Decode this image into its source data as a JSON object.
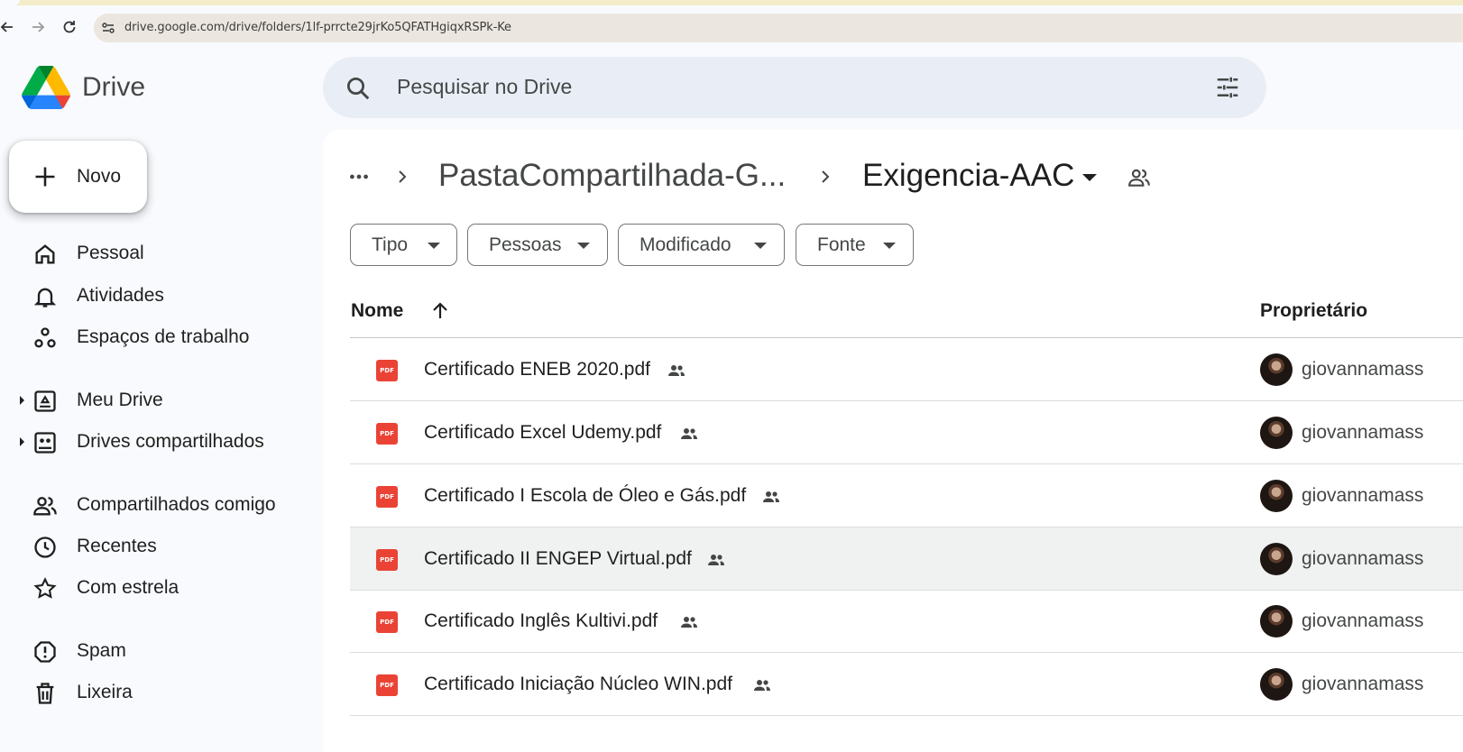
{
  "browser": {
    "url": "drive.google.com/drive/folders/1lf-prrcte29jrKo5QFATHgiqxRSPk-Ke"
  },
  "app": {
    "title": "Drive"
  },
  "search": {
    "placeholder": "Pesquisar no Drive"
  },
  "new_button": {
    "label": "Novo"
  },
  "sidebar": {
    "items": [
      {
        "label": "Pessoal",
        "icon": "home-icon"
      },
      {
        "label": "Atividades",
        "icon": "bell-icon"
      },
      {
        "label": "Espaços de trabalho",
        "icon": "workspaces-icon"
      },
      {
        "label": "Meu Drive",
        "icon": "my-drive-icon"
      },
      {
        "label": "Drives compartilhados",
        "icon": "shared-drives-icon"
      },
      {
        "label": "Compartilhados comigo",
        "icon": "people-icon"
      },
      {
        "label": "Recentes",
        "icon": "clock-icon"
      },
      {
        "label": "Com estrela",
        "icon": "star-icon"
      },
      {
        "label": "Spam",
        "icon": "spam-icon"
      },
      {
        "label": "Lixeira",
        "icon": "trash-icon"
      }
    ]
  },
  "breadcrumb": {
    "parent": "PastaCompartilhada-G...",
    "current": "Exigencia-AAC"
  },
  "filters": [
    {
      "label": "Tipo"
    },
    {
      "label": "Pessoas"
    },
    {
      "label": "Modificado"
    },
    {
      "label": "Fonte"
    }
  ],
  "table": {
    "columns": {
      "name": "Nome",
      "owner": "Proprietário"
    },
    "file_icon_text": "PDF",
    "rows": [
      {
        "name": "Certificado ENEB 2020.pdf",
        "owner": "giovannamass",
        "selected": false
      },
      {
        "name": "Certificado Excel Udemy.pdf",
        "owner": "giovannamass",
        "selected": false
      },
      {
        "name": "Certificado I Escola de Óleo e Gás.pdf",
        "owner": "giovannamass",
        "selected": false
      },
      {
        "name": "Certificado II ENGEP Virtual.pdf",
        "owner": "giovannamass",
        "selected": true
      },
      {
        "name": "Certificado Inglês Kultivi.pdf",
        "owner": "giovannamass",
        "selected": false
      },
      {
        "name": "Certificado Iniciação Núcleo WIN.pdf",
        "owner": "giovannamass",
        "selected": false
      }
    ]
  },
  "colors": {
    "pdf_red": "#ea4335",
    "search_bg": "#e9eef6",
    "page_bg": "#f8fafd",
    "selected_row": "#f0f2f1"
  }
}
